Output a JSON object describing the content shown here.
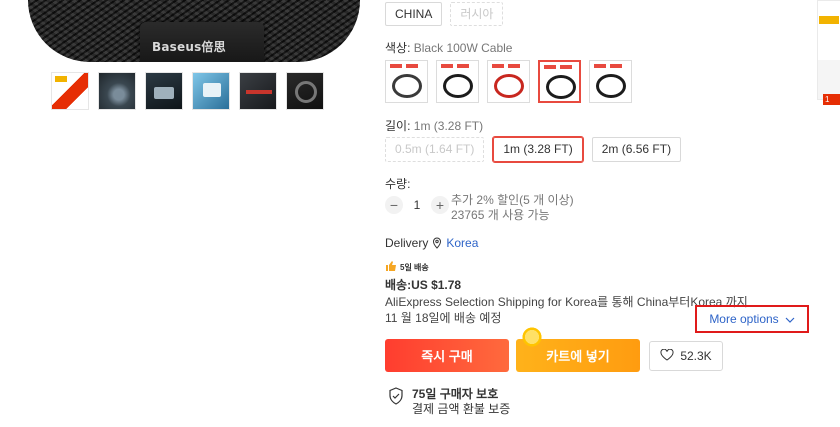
{
  "gallery": {
    "brand_text": "Baseus倍思",
    "thumbnails": [
      "thumb-1",
      "thumb-2",
      "thumb-3",
      "thumb-4",
      "thumb-5",
      "thumb-6"
    ]
  },
  "ship_from": {
    "options": [
      {
        "label": "CHINA",
        "state": "normal"
      },
      {
        "label": "러시아",
        "state": "disabled"
      }
    ]
  },
  "color": {
    "label": "색상:",
    "selected_value": "Black 100W Cable",
    "swatch_count": 5,
    "selected_index": 3
  },
  "length": {
    "label": "길이:",
    "selected_value": "1m (3.28 FT)",
    "options": [
      {
        "label": "0.5m (1.64 FT)",
        "state": "disabled"
      },
      {
        "label": "1m (3.28 FT)",
        "state": "selected"
      },
      {
        "label": "2m (6.56 FT)",
        "state": "normal"
      }
    ]
  },
  "quantity": {
    "label": "수량:",
    "minus": "−",
    "value": "1",
    "plus": "+",
    "discount_note": "추가 2% 할인(5 개 이상)",
    "stock_note": "23765 개 사용 가능"
  },
  "delivery": {
    "label": "Delivery",
    "destination": "Korea",
    "fast_badge": "5일 배송",
    "shipping_price": "배송:US $1.78",
    "description_line1": "AliExpress Selection Shipping for Korea를 통해 China부터Korea 까지",
    "description_line2": "11 월 18일에 배송 예정",
    "more_options": "More options"
  },
  "actions": {
    "buy_now": "즉시 구매",
    "add_to_cart": "카트에 넣기",
    "wishlist_count": "52.3K"
  },
  "protection": {
    "title": "75일 구매자 보호",
    "subtitle": "결제 금액 환불 보증"
  },
  "side_card": {
    "price_fragment": "1"
  },
  "colors": {
    "accent_red": "#e84a3f",
    "link_blue": "#2e64c8",
    "buy_gradient": "#ff3d2f",
    "cart_gradient": "#ffb21a"
  }
}
